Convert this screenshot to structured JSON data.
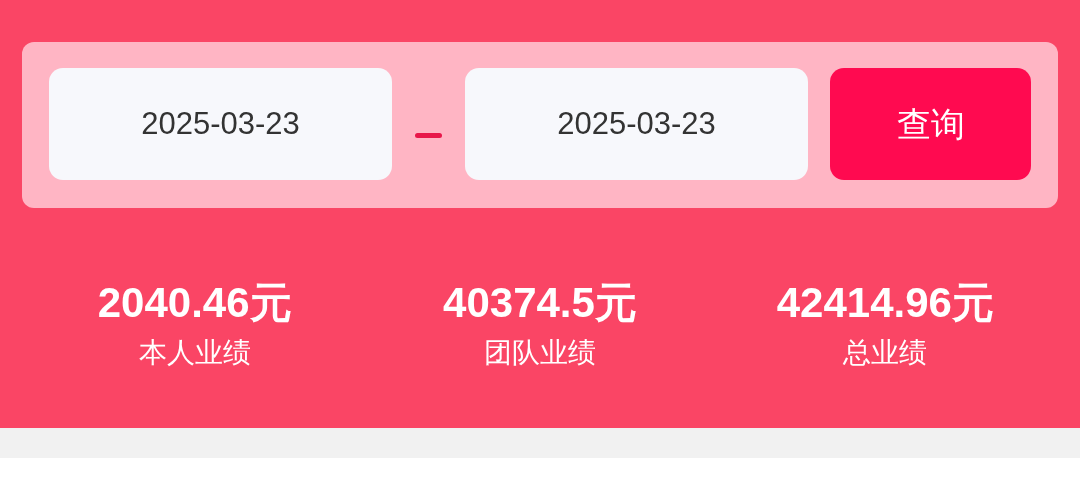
{
  "date_range": {
    "start": "2025-03-23",
    "end": "2025-03-23"
  },
  "query_button": {
    "label": "查询"
  },
  "stats": [
    {
      "value": "2040.46元",
      "label": "本人业绩"
    },
    {
      "value": "40374.5元",
      "label": "团队业绩"
    },
    {
      "value": "42414.96元",
      "label": "总业绩"
    }
  ]
}
